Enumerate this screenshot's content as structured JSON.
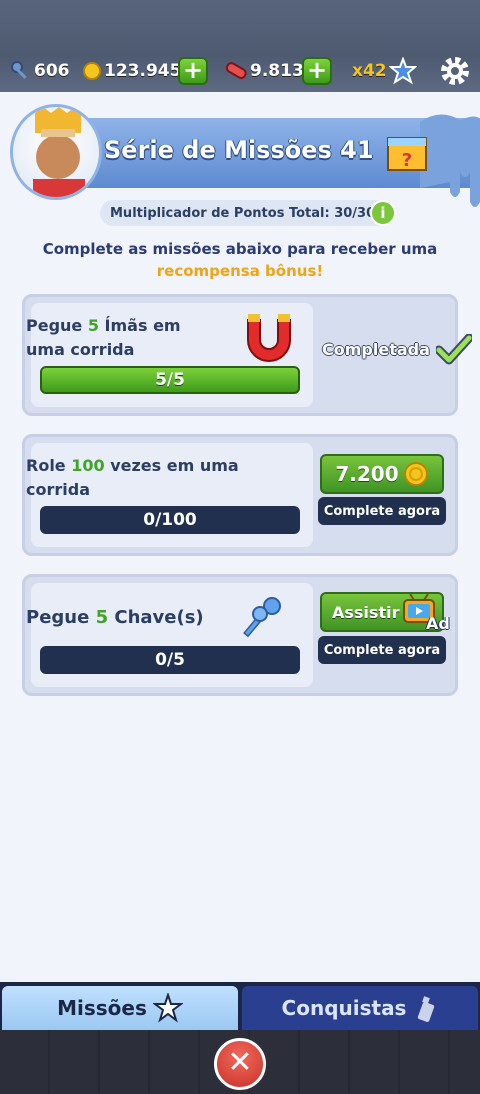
{
  "topbar": {
    "keys": "606",
    "coins": "123.945",
    "hoverboards": "9.813",
    "multiplier": "x42"
  },
  "header": {
    "title": "Série de Missões 41",
    "multiplier_text": "Multiplicador de Pontos Total: 30/30",
    "intro_line1": "Complete as missões abaixo para receber uma",
    "intro_line2": "recompensa bônus!"
  },
  "missions": [
    {
      "text_prefix": "Pegue ",
      "number": "5",
      "text_suffix": " Ímãs em",
      "text_line2": "uma corrida",
      "progress_label": "5/5",
      "progress_fraction": 1.0,
      "status_label": "Completada"
    },
    {
      "text_prefix": "Role ",
      "number": "100",
      "text_suffix": " vezes em uma",
      "text_line2": "corrida",
      "progress_label": "0/100",
      "progress_fraction": 0.0,
      "reward_label": "7.200",
      "complete_label": "Complete agora"
    },
    {
      "text_prefix": "Pegue ",
      "number": "5",
      "text_suffix": " Chave(s)",
      "progress_label": "0/5",
      "progress_fraction": 0.0,
      "reward_label": "Assistir",
      "ad_label": "Ad",
      "complete_label": "Complete agora"
    }
  ],
  "tabs": {
    "missions": "Missões",
    "achievements": "Conquistas"
  },
  "colors": {
    "accent_green": "#3fa526",
    "accent_orange": "#f0a417",
    "navy": "#22304f"
  }
}
